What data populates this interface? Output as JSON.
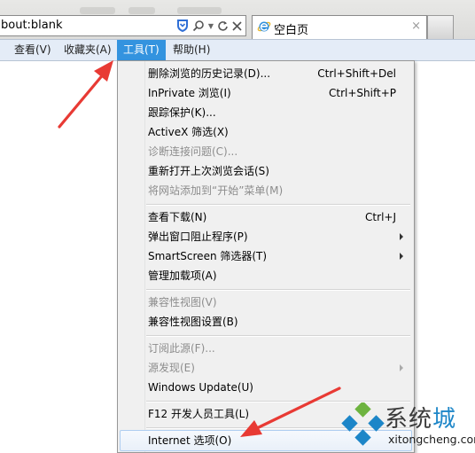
{
  "browser": {
    "address_value": "bout:blank",
    "address_icons": [
      "shield-icon",
      "search-icon",
      "dropdown-icon",
      "refresh-icon",
      "stop-icon"
    ],
    "tab": {
      "title": "空白页",
      "icon": "ie-icon",
      "close": "×"
    }
  },
  "menubar": {
    "items": [
      {
        "label": "查看(V)"
      },
      {
        "label": "收藏夹(A)"
      },
      {
        "label": "工具(T)",
        "active": true
      },
      {
        "label": "帮助(H)"
      }
    ]
  },
  "tools_menu": {
    "items": [
      {
        "label": "删除浏览的历史记录(D)...",
        "shortcut": "Ctrl+Shift+Del"
      },
      {
        "label": "InPrivate 浏览(I)",
        "shortcut": "Ctrl+Shift+P"
      },
      {
        "label": "跟踪保护(K)..."
      },
      {
        "label": "ActiveX 筛选(X)"
      },
      {
        "label": "诊断连接问题(C)...",
        "disabled": true
      },
      {
        "label": "重新打开上次浏览会话(S)"
      },
      {
        "label": "将网站添加到“开始”菜单(M)",
        "disabled": true
      },
      {
        "label": "查看下载(N)",
        "shortcut": "Ctrl+J"
      },
      {
        "label": "弹出窗口阻止程序(P)",
        "submenu": true
      },
      {
        "label": "SmartScreen 筛选器(T)",
        "submenu": true
      },
      {
        "label": "管理加载项(A)"
      },
      {
        "label": "兼容性视图(V)",
        "disabled": true
      },
      {
        "label": "兼容性视图设置(B)"
      },
      {
        "label": "订阅此源(F)...",
        "disabled": true
      },
      {
        "label": "源发现(E)",
        "disabled": true,
        "submenu": true
      },
      {
        "label": "Windows Update(U)"
      },
      {
        "label": "F12 开发人员工具(L)"
      },
      {
        "label": "Internet 选项(O)",
        "highlighted": true
      }
    ]
  },
  "watermark": {
    "cn_part1": "系统",
    "cn_part2": "城",
    "domain": "xitongcheng.com"
  },
  "colors": {
    "menu_active": "#3393df",
    "annotation_arrow": "#e83a34",
    "watermark_blue": "#1d86c8",
    "watermark_green": "#6db33f"
  }
}
